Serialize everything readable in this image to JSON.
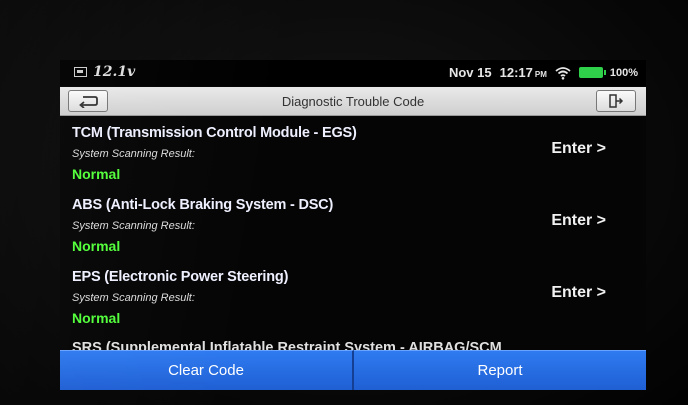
{
  "status_bar": {
    "voltage": "12.1v",
    "date": "Nov 15",
    "time": "12:17",
    "ampm": "PM",
    "battery_percent": "100%",
    "icons": [
      "battery-monitor-icon",
      "wifi-icon",
      "battery-icon"
    ]
  },
  "title_bar": {
    "title": "Diagnostic Trouble Code",
    "back_icon": "back-arrow-icon",
    "exit_icon": "exit-icon"
  },
  "systems": [
    {
      "name": "TCM (Transmission Control Module - EGS)",
      "result_label": "System Scanning Result:",
      "result": "Normal",
      "action": "Enter >"
    },
    {
      "name": "ABS (Anti-Lock Braking System - DSC)",
      "result_label": "System Scanning Result:",
      "result": "Normal",
      "action": "Enter >"
    },
    {
      "name": "EPS (Electronic Power Steering)",
      "result_label": "System Scanning Result:",
      "result": "Normal",
      "action": "Enter >"
    }
  ],
  "partial_item": "SRS (Supplemental Inflatable Restraint System - AIRBAG/SCM",
  "bottom_bar": {
    "clear_label": "Clear Code",
    "report_label": "Report"
  },
  "colors": {
    "normal_status": "#52ff3a",
    "button_blue": "#2a72ea",
    "battery_green": "#2fd14a"
  }
}
